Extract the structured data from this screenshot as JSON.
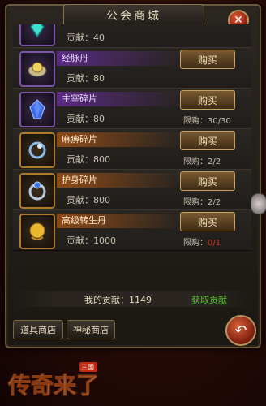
{
  "window": {
    "title": "公会商城"
  },
  "items": [
    {
      "name": "",
      "contribution": "贡献：40",
      "buy": "",
      "limit": "",
      "icon": "cyan-gem-icon",
      "frame": "purple"
    },
    {
      "name": "经脉丹",
      "contribution": "贡献：80",
      "buy": "购买",
      "limit": "",
      "icon": "gold-pill-icon",
      "frame": "purple"
    },
    {
      "name": "主宰碎片",
      "contribution": "贡献：80",
      "buy": "购买",
      "limit_label": "限购：",
      "limit_value": "30/30",
      "icon": "blue-crystal-icon",
      "frame": "purple"
    },
    {
      "name": "麻痹碎片",
      "contribution": "贡献：800",
      "buy": "购买",
      "limit_label": "限购：",
      "limit_value": "2/2",
      "icon": "paralysis-ring-icon",
      "frame": "orange"
    },
    {
      "name": "护身碎片",
      "contribution": "贡献：800",
      "buy": "购买",
      "limit_label": "限购：",
      "limit_value": "2/2",
      "icon": "protection-ring-icon",
      "frame": "orange"
    },
    {
      "name": "高级转生丹",
      "contribution": "贡献：1000",
      "buy": "购买",
      "limit_label": "限购：",
      "limit_value": "0/1",
      "icon": "golden-orb-icon",
      "frame": "orange"
    }
  ],
  "footer": {
    "my_contribution": "我的贡献：1149",
    "get_contribution": "获取贡献"
  },
  "tabs": {
    "item_shop": "道具商店",
    "mystery_shop": "神秘商店"
  },
  "logo": {
    "text": "传奇来了",
    "badge": "三国"
  },
  "colors": {
    "accent_green": "#5ec040",
    "limit_red": "#e03020",
    "gold_border": "#c8a060"
  }
}
